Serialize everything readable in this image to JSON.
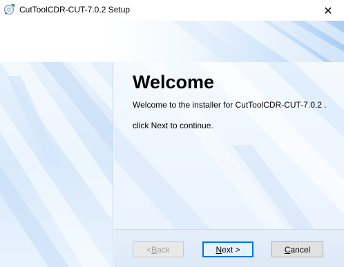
{
  "window": {
    "title": "CutToolCDR-CUT-7.0.2 Setup",
    "close_glyph": "✕"
  },
  "content": {
    "heading": "Welcome",
    "welcome_text": "Welcome to the installer for CutToolCDR-CUT-7.0.2 .",
    "continue_text": "click Next to continue."
  },
  "buttons": {
    "back_accesskey": "B",
    "back_rest": "ack",
    "back_prefix": "< ",
    "next_accesskey": "N",
    "next_rest": "ext >",
    "cancel_accesskey": "C",
    "cancel_rest": "ancel"
  },
  "icons": {
    "app": "installer-disc-icon",
    "close": "close-icon"
  },
  "colors": {
    "accent": "#0078d7",
    "panel": "#eaf3fd",
    "disabled_text": "#a0a0a0"
  }
}
